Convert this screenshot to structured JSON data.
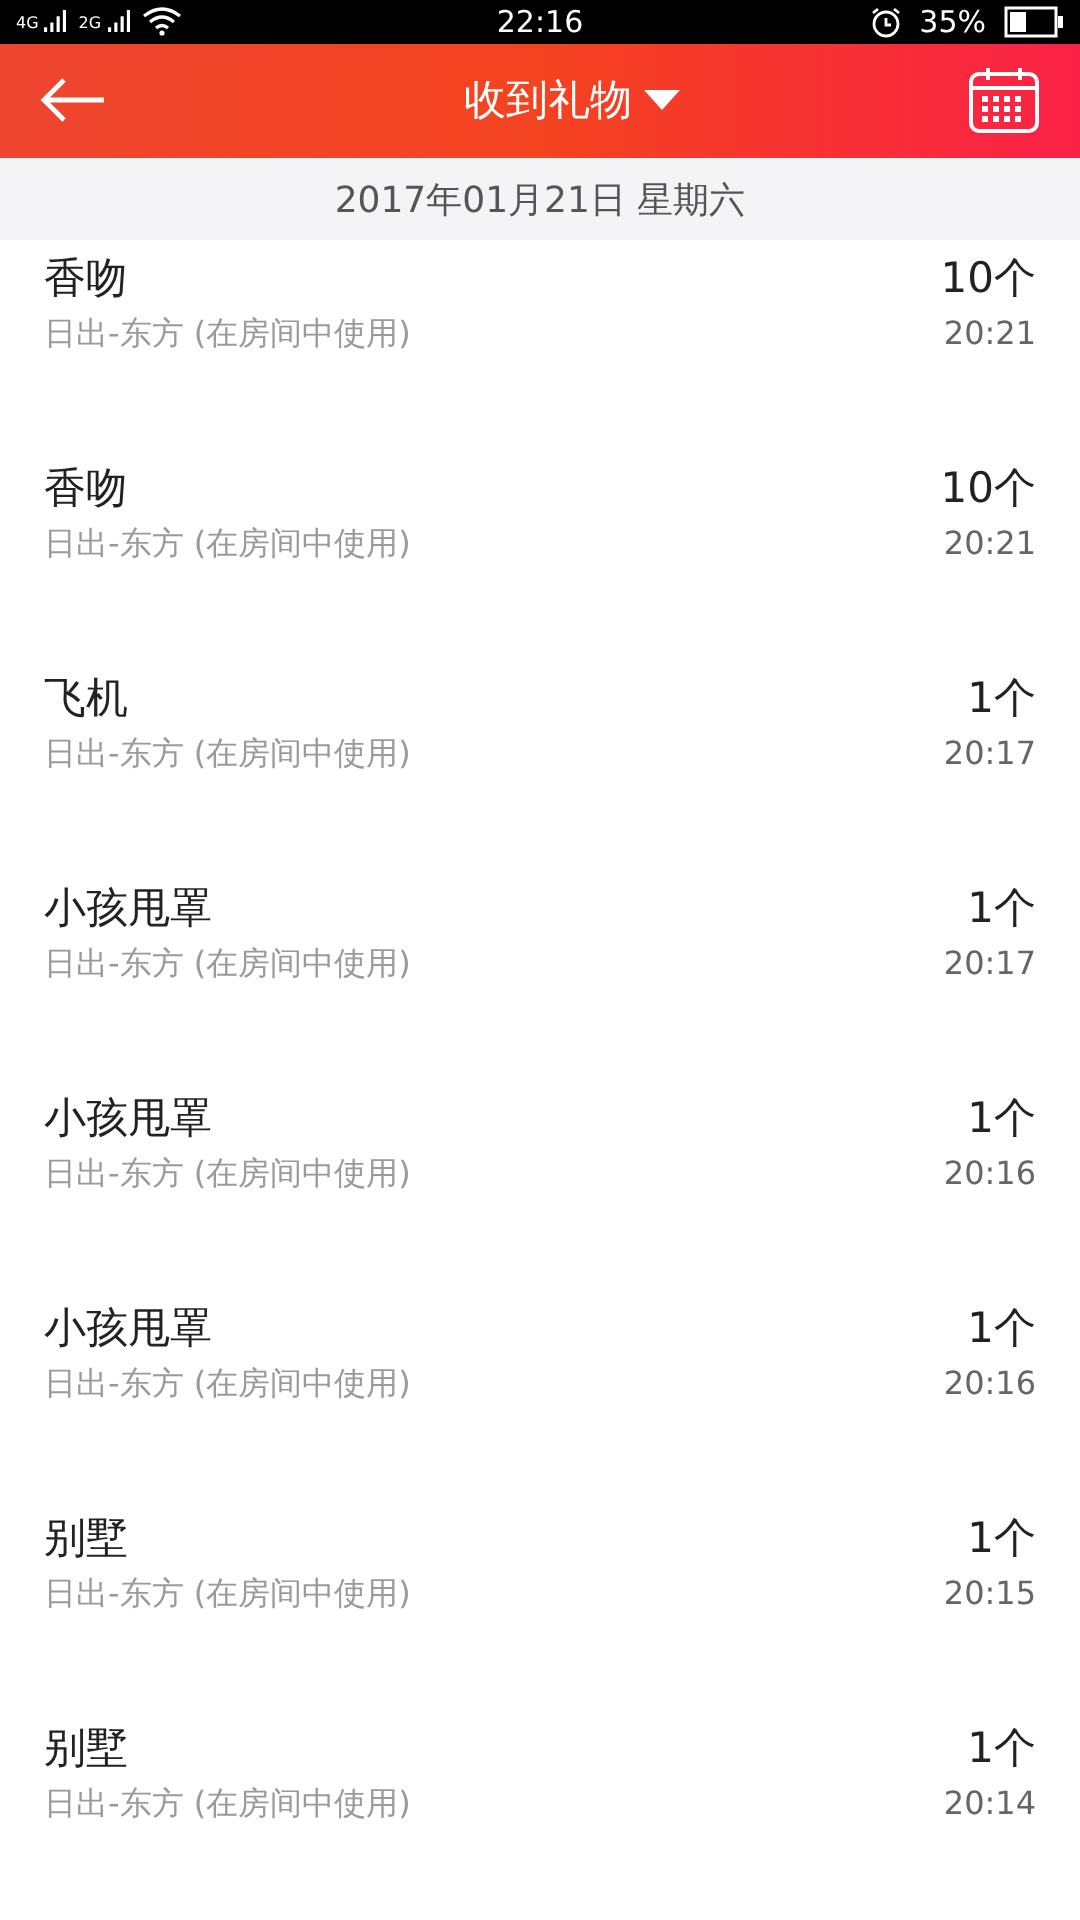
{
  "status_bar": {
    "network_1": "4G",
    "network_2": "2G",
    "time": "22:16",
    "battery": "35%"
  },
  "header": {
    "title": "收到礼物"
  },
  "date_header": "2017年01月21日 星期六",
  "gifts": [
    {
      "name": "香吻",
      "source": "日出-东方 (在房间中使用)",
      "count": "10个",
      "time": "20:21"
    },
    {
      "name": "香吻",
      "source": "日出-东方 (在房间中使用)",
      "count": "10个",
      "time": "20:21"
    },
    {
      "name": "飞机",
      "source": "日出-东方 (在房间中使用)",
      "count": "1个",
      "time": "20:17"
    },
    {
      "name": "小孩甩罩",
      "source": "日出-东方 (在房间中使用)",
      "count": "1个",
      "time": "20:17"
    },
    {
      "name": "小孩甩罩",
      "source": "日出-东方 (在房间中使用)",
      "count": "1个",
      "time": "20:16"
    },
    {
      "name": "小孩甩罩",
      "source": "日出-东方 (在房间中使用)",
      "count": "1个",
      "time": "20:16"
    },
    {
      "name": "别墅",
      "source": "日出-东方 (在房间中使用)",
      "count": "1个",
      "time": "20:15"
    },
    {
      "name": "别墅",
      "source": "日出-东方 (在房间中使用)",
      "count": "1个",
      "time": "20:14"
    }
  ]
}
